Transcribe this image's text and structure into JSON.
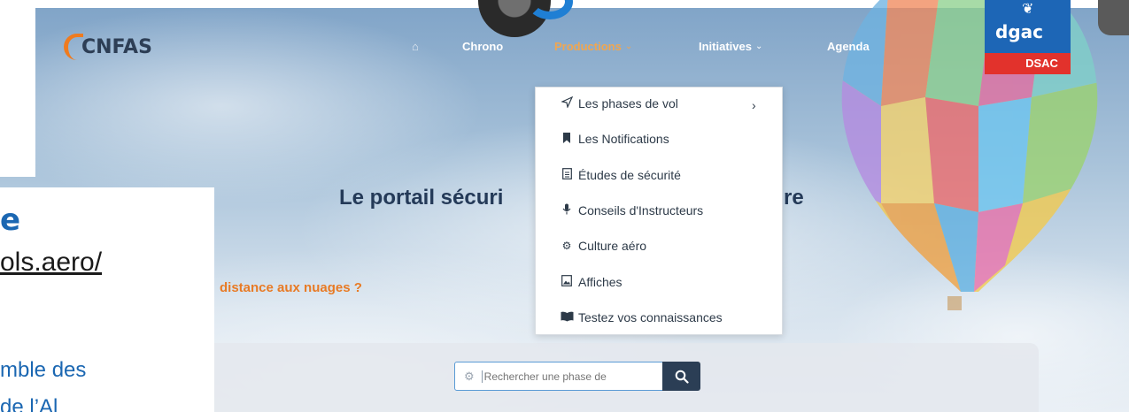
{
  "header": {
    "logo_text": "CNFAS",
    "nav": [
      {
        "label": "Chrono"
      },
      {
        "label": "Productions"
      },
      {
        "label": "Initiatives"
      },
      {
        "label": "Agenda"
      }
    ],
    "agency_logo": {
      "name": "dgac",
      "sub": "DSAC"
    }
  },
  "dropdown": {
    "items": [
      {
        "label": "Les phases de vol",
        "icon": "paper-plane-icon",
        "has_submenu": true
      },
      {
        "label": "Les Notifications",
        "icon": "bookmark-icon"
      },
      {
        "label": "Études de sécurité",
        "icon": "document-icon"
      },
      {
        "label": "Conseils d'Instructeurs",
        "icon": "microphone-icon"
      },
      {
        "label": "Culture aéro",
        "icon": "gear-icon"
      },
      {
        "label": "Affiches",
        "icon": "image-icon"
      },
      {
        "label": "Testez vos connaissances",
        "icon": "book-open-icon"
      }
    ]
  },
  "hero": {
    "title_start": "Le portail sécuri",
    "title_end": "re",
    "question": "distance aux nuages ?"
  },
  "search": {
    "placeholder": "Rechercher une phase de"
  },
  "slide_overlay": {
    "letter": "e",
    "link": "ols.aero/",
    "text_line1": "mble des",
    "text_line2": "  de l’Al"
  },
  "colors": {
    "accent_orange": "#ef7b1f",
    "navy": "#243a58",
    "dgac_blue": "#1d66b6",
    "dsac_red": "#e2322c"
  }
}
